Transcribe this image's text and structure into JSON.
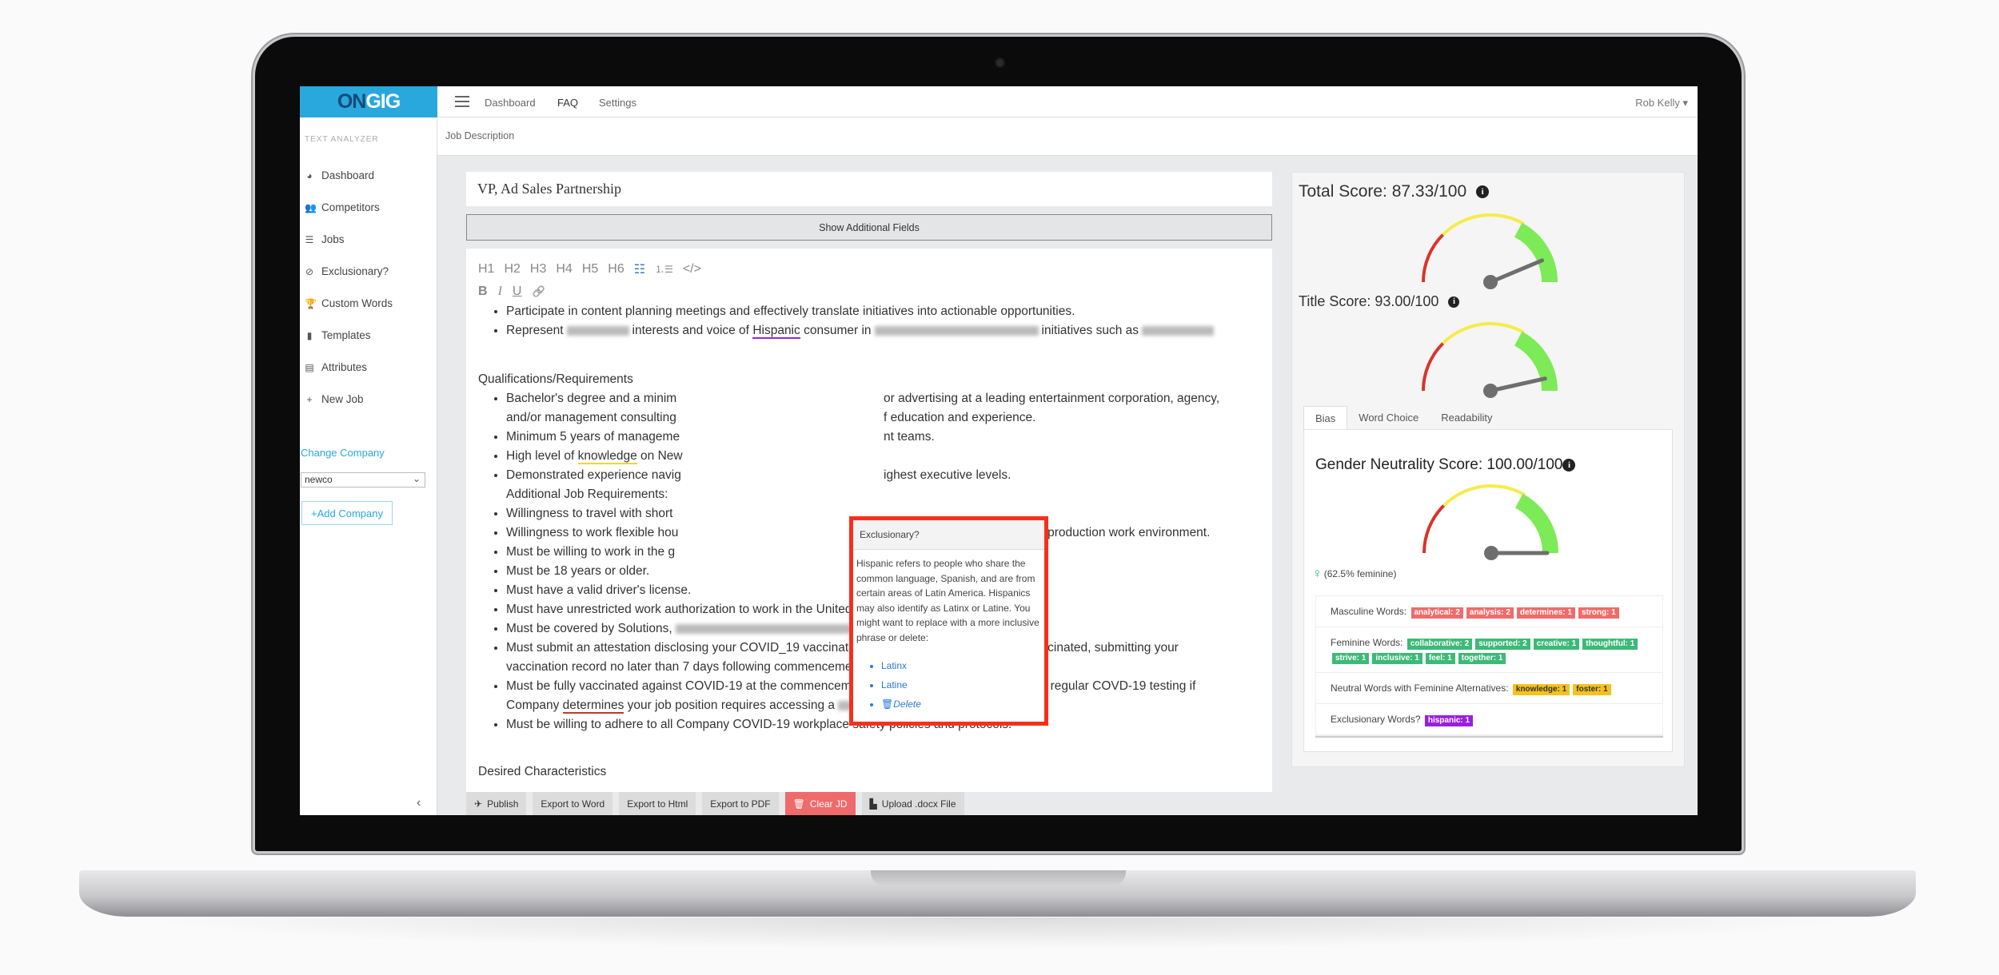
{
  "header": {
    "logo_on": "ON",
    "logo_gig": "GIG",
    "nav": [
      "Dashboard",
      "FAQ",
      "Settings"
    ],
    "user": "Rob Kelly ▾"
  },
  "sidebar": {
    "section": "TEXT ANALYZER",
    "items": [
      {
        "label": "Dashboard",
        "icon": "◕"
      },
      {
        "label": "Competitors",
        "icon": "👥"
      },
      {
        "label": "Jobs",
        "icon": "☰"
      },
      {
        "label": "Exclusionary?",
        "icon": "⊘"
      },
      {
        "label": "Custom Words",
        "icon": "🏆"
      },
      {
        "label": "Templates",
        "icon": "▮"
      },
      {
        "label": "Attributes",
        "icon": "▤"
      },
      {
        "label": "New Job",
        "icon": "+"
      }
    ],
    "change_company": "Change Company",
    "company_select": "newco",
    "add_company": "+Add Company",
    "collapse": "‹"
  },
  "breadcrumb": "Job Description",
  "editor": {
    "title": "VP, Ad Sales Partnership",
    "show_fields": "Show Additional Fields",
    "toolbar": [
      "H1",
      "H2",
      "H3",
      "H4",
      "H5",
      "H6"
    ],
    "list_icon": "☷",
    "olist_icon": "⒈☰",
    "code_icon": "</>",
    "bold": "B",
    "italic": "I",
    "underline": "U",
    "link_icon": "🔗",
    "l1": "Participate in content planning meetings and effectively translate initiatives into actionable opportunities.",
    "l2a": "Represent",
    "l2b": "interests and voice of",
    "l2c": "Hispanic",
    "l2d": "consumer in",
    "l2e": "initiatives such as",
    "quals": "Qualifications/Requirements",
    "q1a": "Bachelor's degree and a minim",
    "q1b": "or advertising at a leading entertainment corporation, agency,",
    "q2a": "and/or management consulting",
    "q2b": "f education and experience.",
    "q3a": "Minimum 5 years of manageme",
    "q3b": "nt teams.",
    "q4a": "High level of",
    "q4b": "knowledge",
    "q4c": "on New",
    "q5a": "Demonstrated experience navig",
    "q5b": "ighest executive levels.",
    "q6": "Additional Job Requirements:",
    "q7": "Willingness to travel with short",
    "q8a": "Willingness to work flexible hou",
    "q8b": "scheduling changes in a 24/7 production work environment.",
    "q9": "Must be willing to work in the g",
    "q10": "Must be 18 years or older.",
    "q11": "Must have a valid driver's license.",
    "q12": "Must have unrestricted work authorization to work in the United States.",
    "q13": "Must be covered by Solutions,",
    "q14": "Must submit an attestation disclosing your COVID_19 vaccination status and, if partially or fully vaccinated, submitting your",
    "q14b": "vaccination record no later than 7 days following commencement of employment.",
    "q15": "Must be fully vaccinated against COVID-19 at the commencement of employment or must undergo regular COVD-19 testing if",
    "q15a": "Company",
    "q15b": "determines",
    "q15c": "your job position requires accessing a",
    "q16": "Must be willing to adhere to all Company COVID-19 workplace safety policies and protocols.",
    "desired": "Desired Characteristics"
  },
  "popup": {
    "title": "Exclusionary?",
    "body": "Hispanic refers to people who share the common language, Spanish, and are from certain areas of Latin America. Hispanics may also identify as Latinx or Latine. You might want to replace with a more inclusive phrase or delete:",
    "options": [
      "Latinx",
      "Latine"
    ],
    "delete": "Delete"
  },
  "actions": [
    {
      "label": "Publish",
      "icon": "✈"
    },
    {
      "label": "Export to Word"
    },
    {
      "label": "Export to Html"
    },
    {
      "label": "Export to PDF"
    },
    {
      "label": "Clear JD",
      "icon": "🗑"
    },
    {
      "label": "Upload .docx File",
      "icon": "▙"
    }
  ],
  "scores": {
    "total": {
      "label": "Total Score: 87.33/100",
      "value": 87.33
    },
    "title": {
      "label": "Title Score: 93.00/100",
      "value": 93.0
    },
    "gender": {
      "label": "Gender Neutrality Score: 100.00/100",
      "value": 100.0
    },
    "feminine_pct": "(62.5% feminine)"
  },
  "gauge_colors": {
    "low": "#d9342b",
    "mid": "#f5ec4a",
    "high": "#7deb57",
    "needle": "#6e6e6e"
  },
  "tabs": [
    "Bias",
    "Word Choice",
    "Readability"
  ],
  "words": {
    "masculine": {
      "label": "Masculine Words:",
      "tags": [
        "analytical: 2",
        "analysis: 2",
        "determines: 1",
        "strong: 1"
      ]
    },
    "feminine": {
      "label": "Feminine Words:",
      "tags": [
        "collaborative: 2",
        "supported: 2",
        "creative: 1",
        "thoughtful: 1",
        "strive: 1",
        "inclusive: 1",
        "feel: 1",
        "together: 1"
      ]
    },
    "neutral": {
      "label": "Neutral Words with Feminine Alternatives:",
      "tags": [
        "knowledge: 1",
        "foster: 1"
      ]
    },
    "exclusionary": {
      "label": "Exclusionary Words?",
      "tags": [
        "hispanic: 1"
      ]
    }
  }
}
